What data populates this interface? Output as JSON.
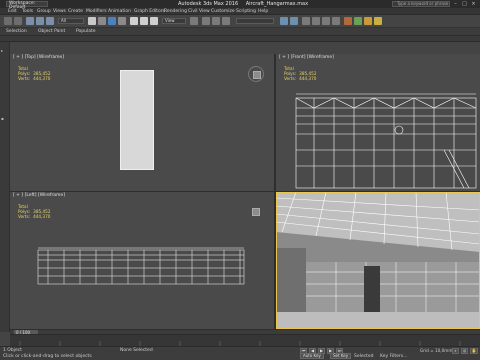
{
  "window": {
    "workspace": "Workspace: Default",
    "app_title": "Autodesk 3ds Max 2016",
    "file_name": "Aircraft_Hangarmax.max",
    "search_placeholder": "Type a keyword or phrase"
  },
  "menu": [
    "Edit",
    "Tools",
    "Group",
    "Views",
    "Create",
    "Modifiers",
    "Animation",
    "Graph Editors",
    "Rendering",
    "Civil View",
    "Customize",
    "Scripting",
    "Help"
  ],
  "toolbar": {
    "selection_filter": "All",
    "view_dropdown": "View"
  },
  "ribbon_tabs": [
    "Selection",
    "Object Paint",
    "Populate"
  ],
  "viewports": {
    "top": {
      "label": "[ + ] [Top] [Wireframe]"
    },
    "front": {
      "label": "[ + ] [Front] [Wireframe]"
    },
    "left": {
      "label": "[ + ] [Left] [Wireframe]"
    },
    "perspective": {
      "label": ""
    }
  },
  "stats": {
    "title": "Total",
    "polys_label": "Polys:",
    "polys": "385,452",
    "verts_label": "Verts:",
    "verts": "444,370"
  },
  "timeline": {
    "frame": "0 / 100"
  },
  "status": {
    "left": "1 Object",
    "selection": "None Selected",
    "prompt": "Click or click-and-drag to select objects",
    "grid": "Grid = 10,0mm",
    "auto_key": "Auto Key",
    "set_key": "Set Key",
    "selected": "Selected",
    "key_filters": "Key Filters..."
  },
  "colors": {
    "accent_active": "#e8c650",
    "stats_text": "#e8d36a",
    "viewport_bg": "#4a4a4a"
  }
}
